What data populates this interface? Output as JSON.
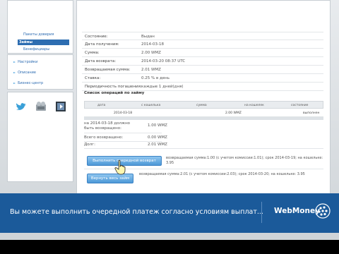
{
  "sidebar": {
    "menu_items": [
      "Пакеты доверия",
      "Займы",
      "Бенефициары"
    ],
    "links": [
      "Настройки",
      "Описание",
      "Бизнес-центр"
    ],
    "social_icons": [
      "twitter-icon",
      "network-icon",
      "video-icon"
    ]
  },
  "loan_info": {
    "rows": [
      {
        "k": "Состояние:",
        "v": "Выдан"
      },
      {
        "k": "Дата получения:",
        "v": "2014-03-18"
      },
      {
        "k": "Сумма:",
        "v": "2.00 WMZ"
      },
      {
        "k": "Дата возврата:",
        "v": "2014-03-20 08:37 UTC"
      },
      {
        "k": "Возвращаемая сумма:",
        "v": "2.01 WMZ"
      },
      {
        "k": "Ставка:",
        "v": "0.25 % в день"
      },
      {
        "k": "Периодичность погашения:",
        "v": "каждые 1 дней(дня)"
      }
    ]
  },
  "operations": {
    "title": "Список операций по займу",
    "headers": [
      "дата",
      "с кошелька",
      "сумма",
      "на кошелек",
      "состояние"
    ],
    "rows": [
      {
        "date": "2014-03-18",
        "from": "",
        "amount": "2.00 WMZ",
        "to": "",
        "status": "выполнен"
      }
    ]
  },
  "summary": {
    "line1": "на 2014-03-18 должно",
    "line2": "быть возвращено:",
    "due": "1.00 WMZ",
    "returned_label": "Всего возвращено:",
    "returned": "0.00 WMZ",
    "debt_label": "Долг:",
    "debt": "2.01 WMZ"
  },
  "actions": {
    "pay_next_button": "Выполнить очередной возврат",
    "pay_next_desc": "возвращаемая сумма:1.00 (с учетом комиссии:1.01); срок 2014-03-19; на кошельке: 3.95",
    "pay_all_button": "Вернуть весь займ",
    "pay_all_desc": "возвращаемая сумма:2.01 (с учетом комиссии:2.03); срок 2014-03-20; на кошельке: 3.95"
  },
  "banner": {
    "text": "Вы можете выполнить очередной платеж согласно условиям выплат...",
    "brand": "WebMoney"
  },
  "colors": {
    "accent": "#2d6db1",
    "banner": "#1b5a9a",
    "button": "#4d98d7"
  }
}
